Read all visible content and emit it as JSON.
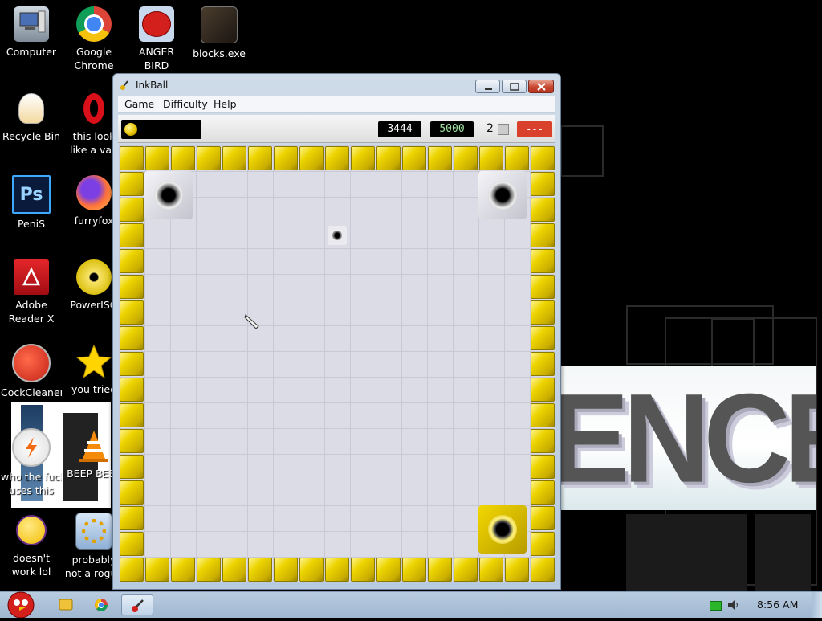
{
  "desktop": {
    "icons": [
      {
        "name": "computer",
        "label1": "Computer",
        "label2": ""
      },
      {
        "name": "google-chrome",
        "label1": "Google",
        "label2": "Chrome"
      },
      {
        "name": "anger-bird",
        "label1": "ANGER",
        "label2": "BIRD"
      },
      {
        "name": "blocks-exe",
        "label1": "blocks.exe",
        "label2": ""
      },
      {
        "name": "recycle-bin",
        "label1": "Recycle Bin",
        "label2": ""
      },
      {
        "name": "opera",
        "label1": "this look",
        "label2": "like a vag"
      },
      {
        "name": "photoshop",
        "label1": "PeniS",
        "label2": ""
      },
      {
        "name": "firefox",
        "label1": "furryfox",
        "label2": ""
      },
      {
        "name": "adobe-reader",
        "label1": "Adobe",
        "label2": "Reader X"
      },
      {
        "name": "poweriso",
        "label1": "PowerISO",
        "label2": ""
      },
      {
        "name": "ccleaner",
        "label1": "CockCleaner",
        "label2": ""
      },
      {
        "name": "star",
        "label1": "you tried",
        "label2": ""
      },
      {
        "name": "winamp",
        "label1": "who the fuck",
        "label2": "uses this"
      },
      {
        "name": "vlc",
        "label1": "BEEP BEEP",
        "label2": ""
      },
      {
        "name": "yahoo",
        "label1": "doesn't",
        "label2": "work lol"
      },
      {
        "name": "settings",
        "label1": "probably",
        "label2": "not a rogue"
      }
    ],
    "banner_text": "ENCE"
  },
  "window": {
    "title": "InkBall",
    "title_icon": "inkball-icon",
    "menus": [
      "Game",
      "Difficulty",
      "Help"
    ],
    "toolbar": {
      "score": "3444",
      "target_score": "5000",
      "lives": "2",
      "timer": "---"
    }
  },
  "taskbar": {
    "clock": "8:56 AM"
  },
  "colors": {
    "wall": "#e6cc00",
    "board": "#dcdce6",
    "close": "#c8472f",
    "taskbar": "#a9c0d8"
  }
}
